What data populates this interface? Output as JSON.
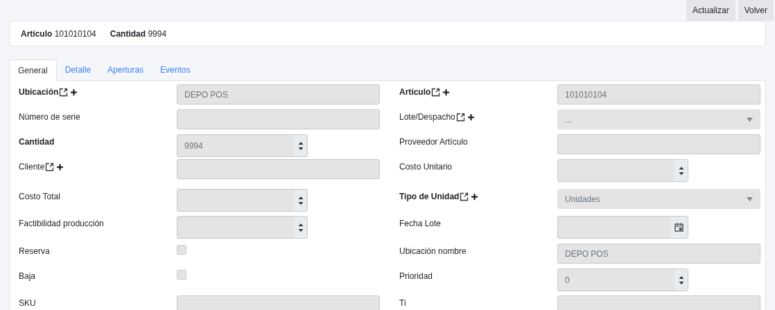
{
  "toolbar": {
    "buttons": [
      "Actualizar",
      "Volver"
    ]
  },
  "summary": [
    {
      "label": "Artículo",
      "value": "101010104"
    },
    {
      "label": "Cantidad",
      "value": "9994"
    }
  ],
  "tabs": [
    {
      "label": "General",
      "selected": true
    },
    {
      "label": "Detalle",
      "selected": false
    },
    {
      "label": "Aperturas",
      "selected": false
    },
    {
      "label": "Eventos",
      "selected": false
    }
  ],
  "form_rows": [
    {
      "left": {
        "label": "Ubicación",
        "bold": true,
        "link_icon": true,
        "add_icon": true,
        "kind": "text",
        "value": "DEPO POS"
      },
      "right": {
        "label": "Artículo",
        "bold": true,
        "link_icon": true,
        "add_icon": true,
        "kind": "text",
        "value": "101010104"
      }
    },
    {
      "left": {
        "label": "Número de serie",
        "bold": false,
        "kind": "text"
      },
      "right": {
        "label": "Lote/Despacho",
        "bold": false,
        "link_icon": true,
        "add_icon": true,
        "kind": "select",
        "value": "..."
      }
    },
    {
      "left": {
        "label": "Cantidad",
        "bold": true,
        "kind": "number",
        "value": "9994"
      },
      "right": {
        "label": "Proveedor Artículo",
        "bold": false,
        "kind": "text"
      }
    },
    {
      "left": {
        "label": "Cliente",
        "bold": false,
        "link_icon": true,
        "add_icon": true,
        "kind": "text"
      },
      "right": {
        "label": "Costo Unitario",
        "bold": false,
        "kind": "number"
      }
    },
    {
      "left": {
        "label": "Costo Total",
        "bold": false,
        "kind": "number"
      },
      "right": {
        "label": "Tipo de Unidad",
        "bold": true,
        "link_icon": true,
        "add_icon": true,
        "kind": "select",
        "value": "Unidades"
      }
    },
    {
      "left": {
        "label": "Factibilidad producción",
        "bold": false,
        "kind": "number"
      },
      "right": {
        "label": "Fecha Lote",
        "bold": false,
        "kind": "date"
      }
    },
    {
      "left": {
        "label": "Reserva",
        "bold": false,
        "kind": "checkbox",
        "checked": false
      },
      "right": {
        "label": "Ubicación nombre",
        "bold": false,
        "kind": "text",
        "value": "DEPO POS"
      }
    },
    {
      "left": {
        "label": "Baja",
        "bold": false,
        "kind": "checkbox",
        "checked": false
      },
      "right": {
        "label": "Prioridad",
        "bold": false,
        "kind": "number",
        "value": "0"
      }
    },
    {
      "left": {
        "label": "SKU",
        "bold": false,
        "kind": "text"
      },
      "right": {
        "label": "Ti",
        "bold": false,
        "kind": "text"
      }
    }
  ]
}
